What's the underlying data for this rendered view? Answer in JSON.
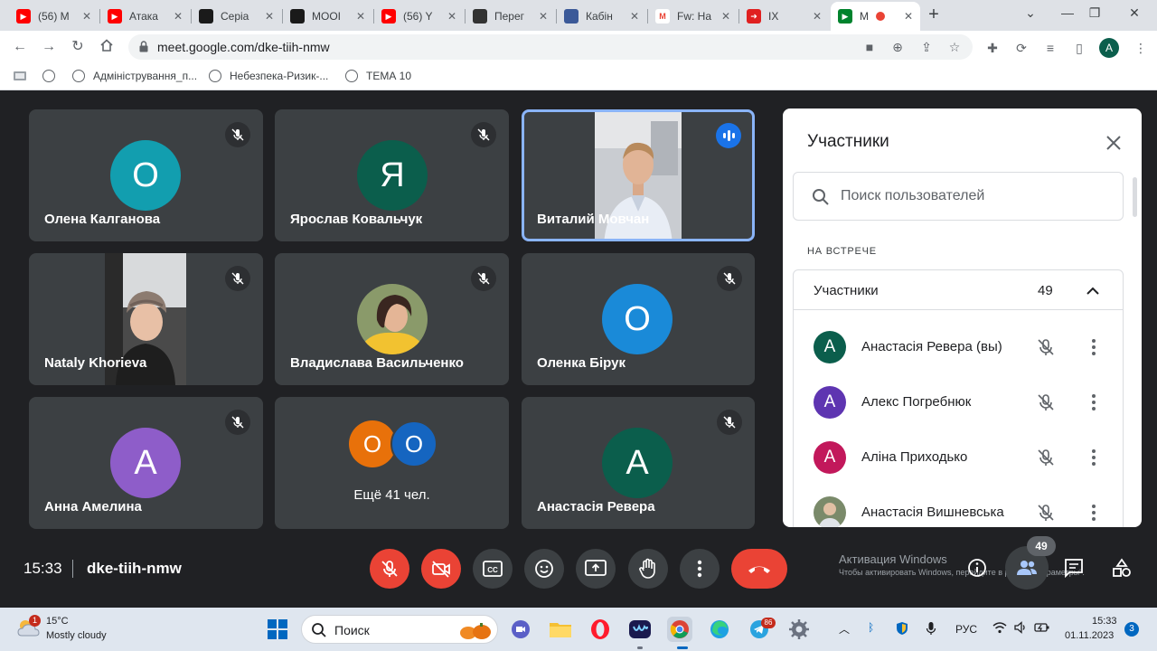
{
  "browser": {
    "tabs": [
      {
        "title": "(56) М",
        "icon": "youtube-icon",
        "color": "#ff0000"
      },
      {
        "title": "Атака",
        "icon": "youtube-icon",
        "color": "#ff0000"
      },
      {
        "title": "Серіа",
        "icon": "serial-icon",
        "color": "#1a1a1a"
      },
      {
        "title": "MOOI",
        "icon": "mooc-icon",
        "color": "#1a1a1a"
      },
      {
        "title": "(56) Y",
        "icon": "youtube-icon",
        "color": "#ff0000"
      },
      {
        "title": "Перег",
        "icon": "avatar-icon",
        "color": "#333333"
      },
      {
        "title": "Кабін",
        "icon": "cabinet-icon",
        "color": "#3b5998"
      },
      {
        "title": "Fw: Ha",
        "icon": "gmail-icon",
        "color": "#ea4335"
      },
      {
        "title": "IX",
        "icon": "arrow-icon",
        "color": "#e02020"
      },
      {
        "title": "M",
        "icon": "meet-icon",
        "color": "#00832d",
        "active": true
      }
    ],
    "url": "meet.google.com/dke-tiih-nmw",
    "profile_initial": "A",
    "bookmarks": [
      "Адміністрування_п...",
      "Небезпека-Ризик-...",
      "ТЕМА 10"
    ]
  },
  "tiles": [
    {
      "name": "Олена Калганова",
      "initial": "О",
      "color": "#129eaf",
      "muted": true
    },
    {
      "name": "Ярослав Ковальчук",
      "initial": "Я",
      "color": "#0b5e4c",
      "muted": true
    },
    {
      "name": "Виталий Мовчан",
      "video": true,
      "speaking": true
    },
    {
      "name": "Nataly Khorieva",
      "video": true,
      "muted": true
    },
    {
      "name": "Владислава Васильченко",
      "photo": true,
      "muted": true
    },
    {
      "name": "Оленка Бірук",
      "initial": "О",
      "color": "#1a8ad8",
      "muted": true
    },
    {
      "name": "Анна Амелина",
      "initial": "А",
      "color": "#8e5dc9",
      "muted": true
    },
    {
      "more": true,
      "label": "Ещё 41 чел.",
      "initials": [
        "О",
        "О"
      ],
      "colors": [
        "#e8710a",
        "#1565c0"
      ]
    },
    {
      "name": "Анастасія Ревера",
      "initial": "А",
      "color": "#0b5e4c",
      "muted": true
    }
  ],
  "panel": {
    "title": "Участники",
    "search_placeholder": "Поиск пользователей",
    "section": "НА ВСТРЕЧЕ",
    "group_title": "Участники",
    "group_count": "49",
    "people": [
      {
        "name": "Анастасія Ревера (вы)",
        "initial": "А",
        "color": "#0b5e4c"
      },
      {
        "name": "Алекс Погребнюк",
        "initial": "А",
        "color": "#5e35b1"
      },
      {
        "name": "Аліна Приходько",
        "initial": "А",
        "color": "#c2185b"
      },
      {
        "name": "Анастасія Вишневська",
        "photo": true
      }
    ]
  },
  "controls": {
    "time": "15:33",
    "meeting_code": "dke-tiih-nmw",
    "activation_title": "Активация Windows",
    "activation_text": "Чтобы активировать Windows, перейдите в раздел \"Параметры\".",
    "participants_count": "49"
  },
  "taskbar": {
    "weather_badge": "1",
    "temperature": "15°C",
    "weather_desc": "Mostly cloudy",
    "search_placeholder": "Поиск",
    "telegram_badge": "86",
    "language": "РУС",
    "clock_time": "15:33",
    "clock_date": "01.11.2023",
    "notifications": "3"
  }
}
